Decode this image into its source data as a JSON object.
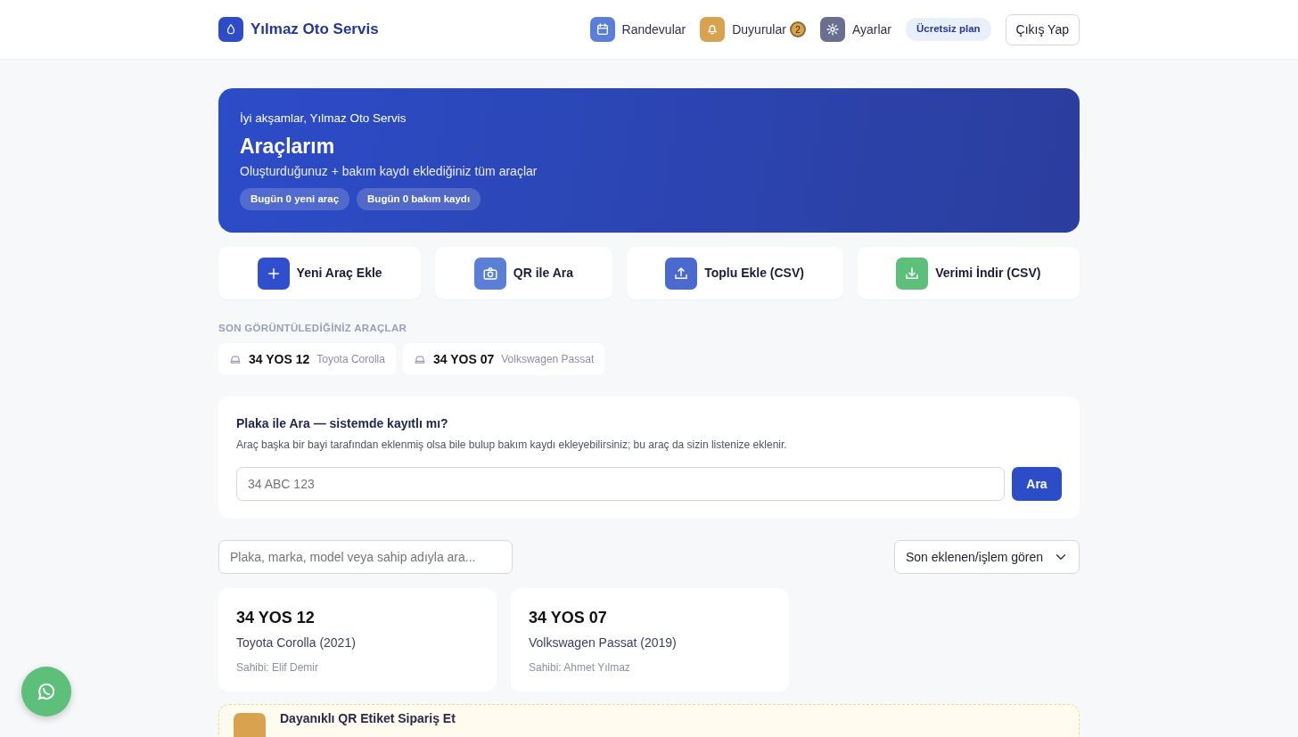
{
  "brand": {
    "name": "Yılmaz Oto Servis"
  },
  "nav": [
    {
      "kind": "calendar",
      "label": "Randevular",
      "color": "#5b7fd6"
    },
    {
      "kind": "bell",
      "label": "Duyurular",
      "color": "#d9a24e",
      "badge": "2"
    },
    {
      "kind": "gear",
      "label": "Ayarlar",
      "color": "#6b6f8f"
    }
  ],
  "plan": "Ücretsiz plan",
  "logout": "Çıkış Yap",
  "hero": {
    "greeting": "İyi akşamlar, Yılmaz Oto Servis",
    "title": "Araçlarım",
    "subtitle": "Oluşturduğunuz + bakım kaydı eklediğiniz tüm araçlar",
    "chips": [
      "Bugün 0 yeni araç",
      "Bugün 0 bakım kaydı"
    ]
  },
  "actions": [
    {
      "kind": "plus",
      "label": "Yeni Araç Ekle",
      "color": "#2f4fcf"
    },
    {
      "kind": "camera",
      "label": "QR ile Ara",
      "color": "#5b7fd6"
    },
    {
      "kind": "upload",
      "label": "Toplu Ekle (CSV)",
      "color": "#4a6ad0"
    },
    {
      "kind": "download",
      "label": "Verimi İndir (CSV)",
      "color": "#5cbf7a"
    }
  ],
  "recent": {
    "heading": "SON GÖRÜNTÜLEDİĞİNİZ ARAÇLAR",
    "items": [
      {
        "plate": "34 YOS 12",
        "model": "Toyota Corolla"
      },
      {
        "plate": "34 YOS 07",
        "model": "Volkswagen Passat"
      }
    ]
  },
  "plate_search": {
    "title": "Plaka ile Ara — sistemde kayıtlı mı?",
    "description": "Araç başka bir bayi tarafından eklenmiş olsa bile bulup bakım kaydı ekleyebilirsiniz; bu araç da sizin listenize eklenir.",
    "placeholder": "34 ABC 123",
    "button": "Ara"
  },
  "filter": {
    "placeholder": "Plaka, marka, model veya sahip adıyla ara...",
    "sort": "Son eklenen/işlem gören"
  },
  "vehicles": [
    {
      "plate": "34 YOS 12",
      "model": "Toyota Corolla (2021)",
      "owner": "Sahibi: Elif Demir"
    },
    {
      "plate": "34 YOS 07",
      "model": "Volkswagen Passat (2019)",
      "owner": "Sahibi: Ahmet Yılmaz"
    }
  ],
  "promo": {
    "title": "Dayanıklı QR Etiket Sipariş Et"
  }
}
